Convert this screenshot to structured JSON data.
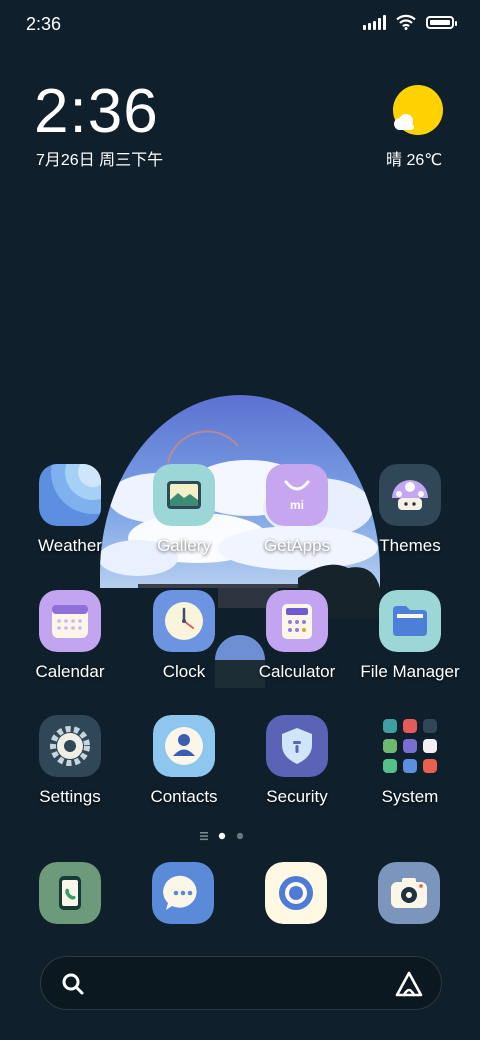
{
  "status_bar": {
    "time": "2:36"
  },
  "widget": {
    "time": "2:36",
    "date": "7月26日 周三下午",
    "weather": "晴 26℃"
  },
  "apps": [
    {
      "label": "Weather"
    },
    {
      "label": "Gallery"
    },
    {
      "label": "GetApps"
    },
    {
      "label": "Themes"
    },
    {
      "label": "Calendar"
    },
    {
      "label": "Clock"
    },
    {
      "label": "Calculator"
    },
    {
      "label": "File Manager"
    },
    {
      "label": "Settings"
    },
    {
      "label": "Contacts"
    },
    {
      "label": "Security"
    },
    {
      "label": "System"
    }
  ],
  "getapps_logo_text": "mi",
  "page_indicator": {
    "pages": 2,
    "current_page": 1
  },
  "dock": [
    "phone-icon",
    "messages-icon",
    "browser-icon",
    "camera-icon"
  ],
  "colors": {
    "background": "#0f1f2b",
    "weather_sun": "#ffd200",
    "settings_icon": "#2f4756",
    "contacts_icon": "#8ec6ef",
    "security_icon": "#5b63b7",
    "phone_icon": "#6d9a7a",
    "messages_icon": "#5a8ad8",
    "browser_icon": "#fff8e2",
    "camera_icon": "#7b95bd"
  }
}
